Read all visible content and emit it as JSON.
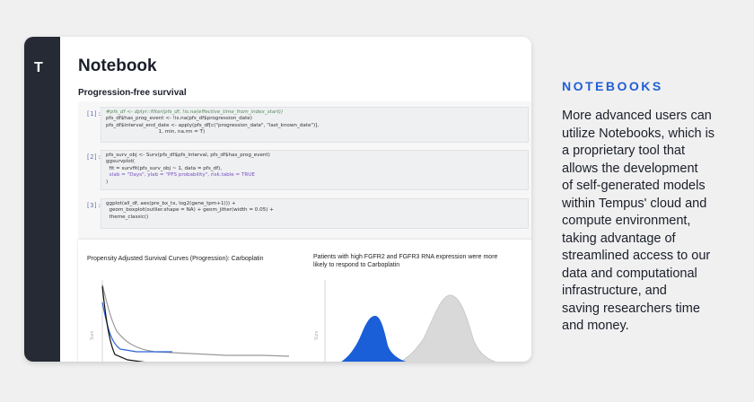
{
  "app": {
    "logo_text": "T",
    "title": "Notebook",
    "section_title": "Progression-free survival"
  },
  "cells": [
    {
      "number": "[1]:",
      "lines": [
        "#pfs_df <- dplyr::filter(pfs_df, !is.na(effective_time_from_index_start))",
        "pfs_df$has_prog_event <- !is.na(pfs_df$progression_date)",
        "pfs_df$interval_end_date <- apply(pfs_df[c(\"progression_date\", \"last_known_date\")],",
        "                                 1, min, na.rm = T)"
      ]
    },
    {
      "number": "[2]:",
      "lines": [
        "pfs_surv_obj <- Surv(pfs_df$pfs_interval, pfs_df$has_prog_event)",
        "ggsurvplot(",
        "  fit = survfit(pfs_surv_obj ~ 1, data = pfs_df),",
        "  xlab = \"Days\", ylab = \"PFS probability\", risk.table = TRUE",
        ")"
      ]
    },
    {
      "number": "[3]:",
      "lines": [
        "ggplot(all_df, aes(pre_bx_tx, log2(gene_tpm+1))) +",
        "  geom_boxplot(outlier.shape = NA) + geom_jitter(width = 0.05) +",
        "  theme_classic()"
      ]
    }
  ],
  "charts": {
    "left_title": "Propensity Adjusted Survival Curves (Progression): Carboplatin",
    "left_ylabel": "Surv",
    "right_title_line1": "Patients with high FGFR2 and FGFR3 RNA expression were more",
    "right_title_line2": "likely to respond to Carboplatin",
    "right_ylabel": "Surv",
    "colors": {
      "black": "#111111",
      "gray": "#999999",
      "blue": "#2b63d6",
      "density_blue": "#1a5fd8",
      "density_gray": "#d9d9d9"
    }
  },
  "promo": {
    "heading": "NOTEBOOKS",
    "body_lines": [
      "More advanced users can",
      "utilize Notebooks, which is",
      "a proprietary tool that",
      "allows the development",
      "of self-generated models",
      "within Tempus' cloud and",
      "compute environment,",
      "taking advantage of",
      "streamlined access to our",
      "data and computational",
      "infrastructure, and",
      "saving researchers time",
      "and money."
    ]
  }
}
